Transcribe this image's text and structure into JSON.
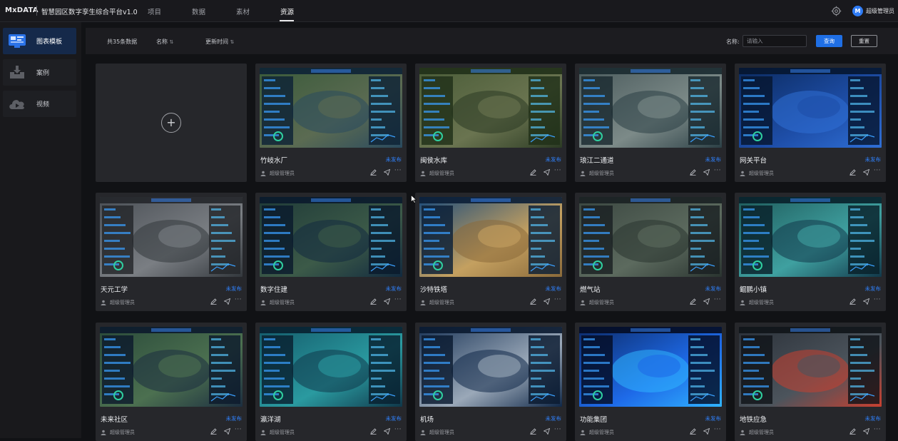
{
  "app": {
    "logo": "MxDATA",
    "title": "智慧园区数字孪生综合平台v1.0"
  },
  "nav": {
    "tabs": [
      {
        "label": "项目"
      },
      {
        "label": "数据"
      },
      {
        "label": "素材"
      },
      {
        "label": "资源"
      }
    ],
    "active": "资源"
  },
  "user": {
    "avatar_letter": "M",
    "name": "超级管理员"
  },
  "sidebar": {
    "items": [
      {
        "label": "图表模板",
        "icon": "dashboard-template-icon",
        "active": true
      },
      {
        "label": "案例",
        "icon": "download-box-icon",
        "active": false
      },
      {
        "label": "视频",
        "icon": "cloud-video-icon",
        "active": false
      }
    ]
  },
  "filter": {
    "total": "共35条数据",
    "sort_name": "名称",
    "sort_time": "更新时间",
    "sort_glyph": "⇅",
    "name_label": "名称:",
    "search_placeholder": "请输入",
    "search_button": "查询",
    "reset_button": "重置"
  },
  "cards": [
    {
      "title": "竹岐水厂",
      "status": "未发布",
      "author": "超级管理员",
      "theme": "aerial-river"
    },
    {
      "title": "闽侯水库",
      "status": "未发布",
      "author": "超级管理员",
      "theme": "terrain-map"
    },
    {
      "title": "琅江二通道",
      "status": "未发布",
      "author": "超级管理员",
      "theme": "building-3d"
    },
    {
      "title": "网关平台",
      "status": "未发布",
      "author": "超级管理员",
      "theme": "region-map"
    },
    {
      "title": "天元工学",
      "status": "未发布",
      "author": "超级管理员",
      "theme": "city-aerial"
    },
    {
      "title": "数字住建",
      "status": "未发布",
      "author": "超级管理员",
      "theme": "dark-map"
    },
    {
      "title": "沙特铁塔",
      "status": "未发布",
      "author": "超级管理员",
      "theme": "peninsula-map"
    },
    {
      "title": "燃气站",
      "status": "未发布",
      "author": "超级管理员",
      "theme": "site-aerial"
    },
    {
      "title": "鲲鹏小镇",
      "status": "未发布",
      "author": "超级管理员",
      "theme": "town-3d"
    },
    {
      "title": "未来社区",
      "status": "未发布",
      "author": "超级管理员",
      "theme": "community"
    },
    {
      "title": "瀛洋湖",
      "status": "未发布",
      "author": "超级管理员",
      "theme": "lake-park"
    },
    {
      "title": "机场",
      "status": "未发布",
      "author": "超级管理员",
      "theme": "airport"
    },
    {
      "title": "功能集团",
      "status": "未发布",
      "author": "超级管理员",
      "theme": "neon-campus"
    },
    {
      "title": "地铁应急",
      "status": "未发布",
      "author": "超级管理员",
      "theme": "metro-map"
    }
  ],
  "colors": {
    "accent": "#1f6fe5",
    "status": "#2f82ff",
    "active_sidebar": "#15294a"
  }
}
